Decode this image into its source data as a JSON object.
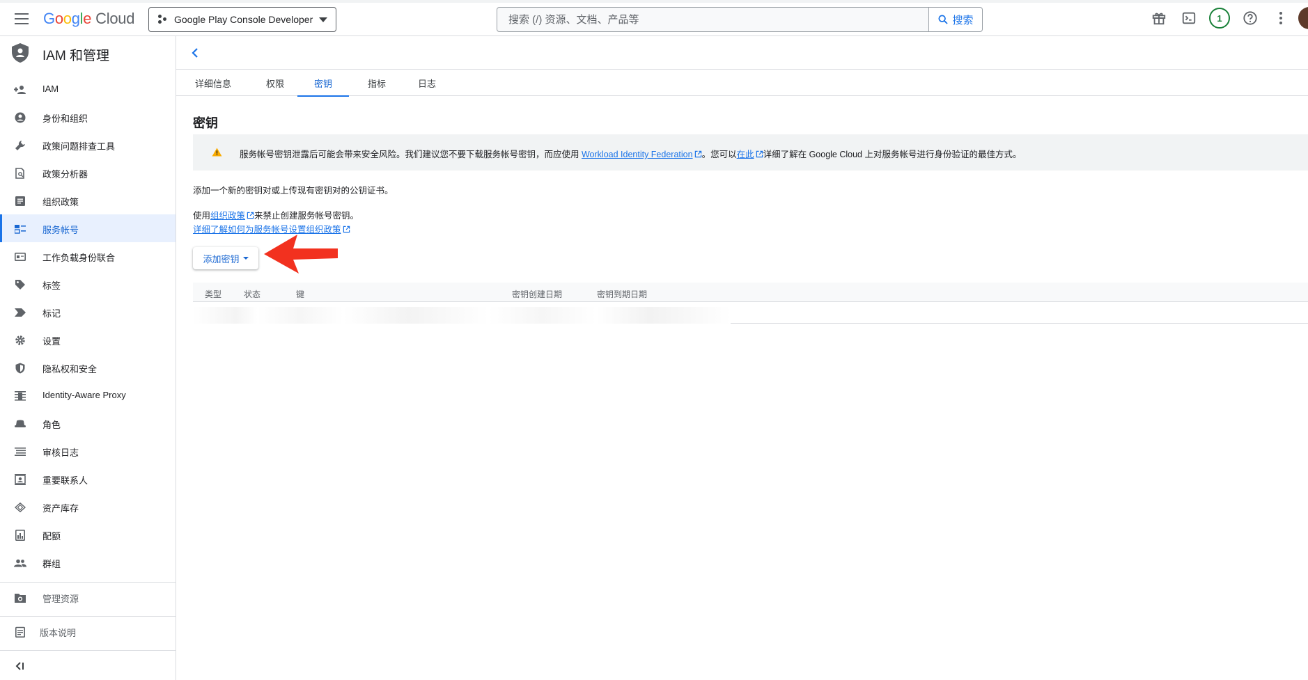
{
  "header": {
    "logo_letters": [
      "G",
      "o",
      "o",
      "g",
      "l",
      "e"
    ],
    "logo_suffix": "Cloud",
    "project": "Google Play Console Developer",
    "search_placeholder": "搜索 (/) 资源、文档、产品等",
    "search_button": "搜索",
    "notification_count": "1"
  },
  "sidebar": {
    "title": "IAM 和管理",
    "items": [
      {
        "label": "IAM",
        "icon": "person-add-icon"
      },
      {
        "label": "身份和组织",
        "icon": "account-circle-icon"
      },
      {
        "label": "政策问题排查工具",
        "icon": "wrench-icon"
      },
      {
        "label": "政策分析器",
        "icon": "document-search-icon"
      },
      {
        "label": "组织政策",
        "icon": "article-icon"
      },
      {
        "label": "服务帐号",
        "icon": "service-account-icon"
      },
      {
        "label": "工作负载身份联合",
        "icon": "id-card-icon"
      },
      {
        "label": "标签",
        "icon": "tag-icon"
      },
      {
        "label": "标记",
        "icon": "label-icon"
      },
      {
        "label": "设置",
        "icon": "gear-icon"
      },
      {
        "label": "隐私权和安全",
        "icon": "shield-icon"
      },
      {
        "label": "Identity-Aware Proxy",
        "icon": "proxy-icon"
      },
      {
        "label": "角色",
        "icon": "hat-icon"
      },
      {
        "label": "审核日志",
        "icon": "list-icon"
      },
      {
        "label": "重要联系人",
        "icon": "contact-icon"
      },
      {
        "label": "资产库存",
        "icon": "diamond-icon"
      },
      {
        "label": "配额",
        "icon": "quota-icon"
      },
      {
        "label": "群组",
        "icon": "group-icon"
      }
    ],
    "manage_resources": "管理资源",
    "release_notes": "版本说明"
  },
  "tabs": [
    "详细信息",
    "权限",
    "密钥",
    "指标",
    "日志"
  ],
  "content": {
    "title": "密钥",
    "warning_pre": "服务帐号密钥泄露后可能会带来安全风险。我们建议您不要下载服务帐号密钥，而应使用 ",
    "warning_link1": "Workload Identity Federation",
    "warning_mid": "。您可以",
    "warning_link2": "在此",
    "warning_post": "详细了解在 Google Cloud 上对服务帐号进行身份验证的最佳方式。",
    "para1": "添加一个新的密钥对或上传现有密钥对的公钥证书。",
    "para2_pre": "使用",
    "para2_link": "组织政策",
    "para2_post": "来禁止创建服务帐号密钥。",
    "para3_link": "详细了解如何为服务帐号设置组织政策",
    "add_key_button": "添加密钥"
  },
  "table": {
    "columns": [
      "类型",
      "状态",
      "键",
      "密钥创建日期",
      "密钥到期日期"
    ]
  },
  "colors": {
    "accent": "#1a73e8",
    "annotation_arrow": "#f2311f",
    "warning": "#f9ab00"
  }
}
